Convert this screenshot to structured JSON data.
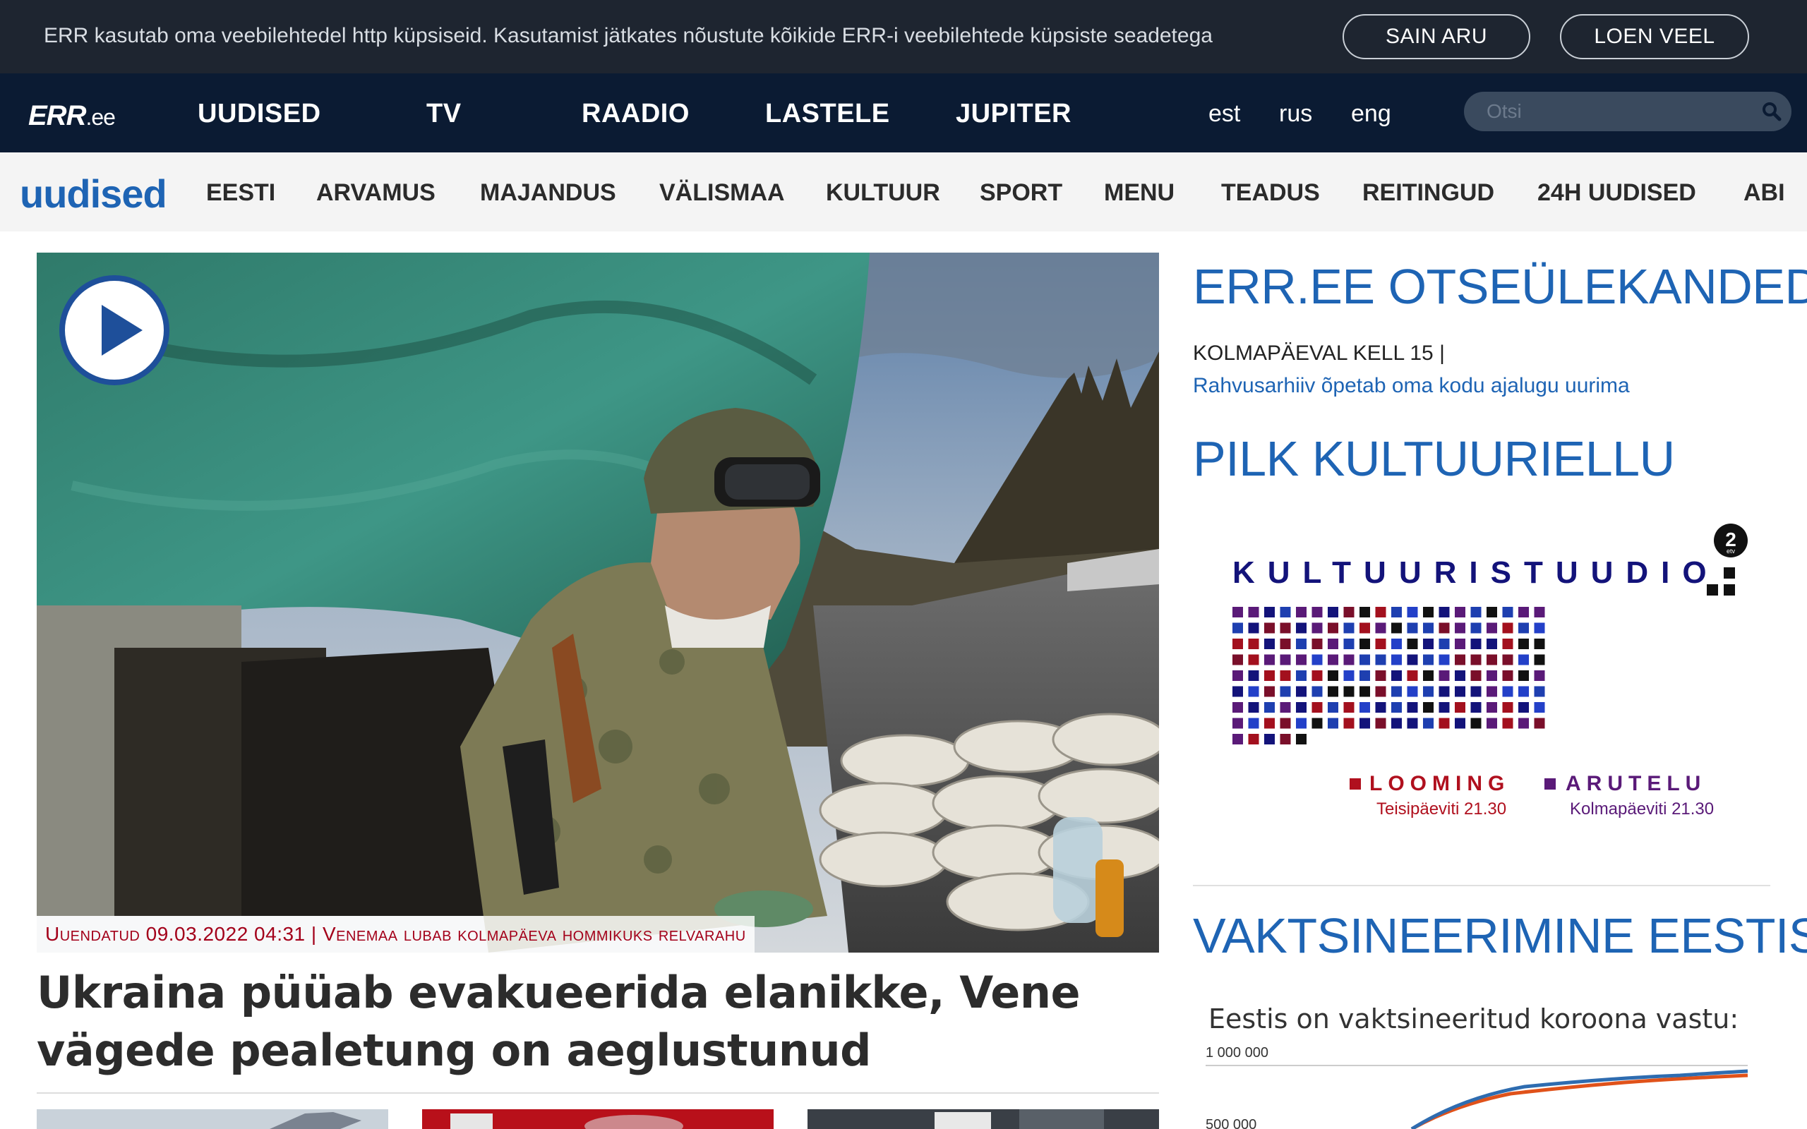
{
  "cookie_bar": {
    "text": "ERR kasutab oma veebilehtedel http küpsiseid. Kasutamist jätkates nõustute kõikide ERR-i veebilehtede küpsiste seadetega",
    "agree_label": "SAIN ARU",
    "more_label": "LOEN VEEL"
  },
  "top_nav": {
    "logo": "ERR",
    "logo_suffix": ".ee",
    "items": [
      "UUDISED",
      "TV",
      "RAADIO",
      "LASTELE",
      "JUPITER"
    ],
    "languages": [
      "est",
      "rus",
      "eng"
    ],
    "search_placeholder": "Otsi"
  },
  "sub_nav": {
    "section": "uudised",
    "items": [
      "EESTI",
      "ARVAMUS",
      "MAJANDUS",
      "VÄLISMAA",
      "KULTUUR",
      "SPORT",
      "MENU",
      "TEADUS",
      "REITINGUD",
      "24H UUDISED",
      "ABI"
    ]
  },
  "main_story": {
    "caption": "Uuendatud 09.03.2022 04:31 | Venemaa lubab kolmapäeva hommikuks relvarahu",
    "headline": "Ukraina püüab evakueerida elanikke, Vene vägede pealetung on aeglustunud"
  },
  "sidebar": {
    "live_title": "ERR.EE OTSEÜLEKANDED",
    "live_time": "KOLMAPÄEVAL KELL 15 |",
    "live_link": "Rahvusarhiiv õpetab oma kodu ajalugu uurima",
    "culture_title": "PILK KULTUURIELLU",
    "culture_banner": {
      "title": "KULTUURISTUUDIO",
      "channel_badge": "2",
      "channel_sub": "etv",
      "show1": "LOOMING",
      "show1_time": "Teisipäeviti 21.30",
      "show2": "ARUTELU",
      "show2_time": "Kolmapäeviti 21.30"
    },
    "vacc_title": "VAKTSINEERIMINE EESTIS",
    "vacc_subtitle": "Eestis on vaktsineeritud koroona vastu:",
    "vacc_tick_top": "1 000 000",
    "vacc_tick_mid": "500 000"
  },
  "colors": {
    "brand_blue": "#1e64b4",
    "nav_bg": "#0b1b33",
    "cookie_bg": "#1e2530",
    "caption_red": "#a3001a"
  }
}
